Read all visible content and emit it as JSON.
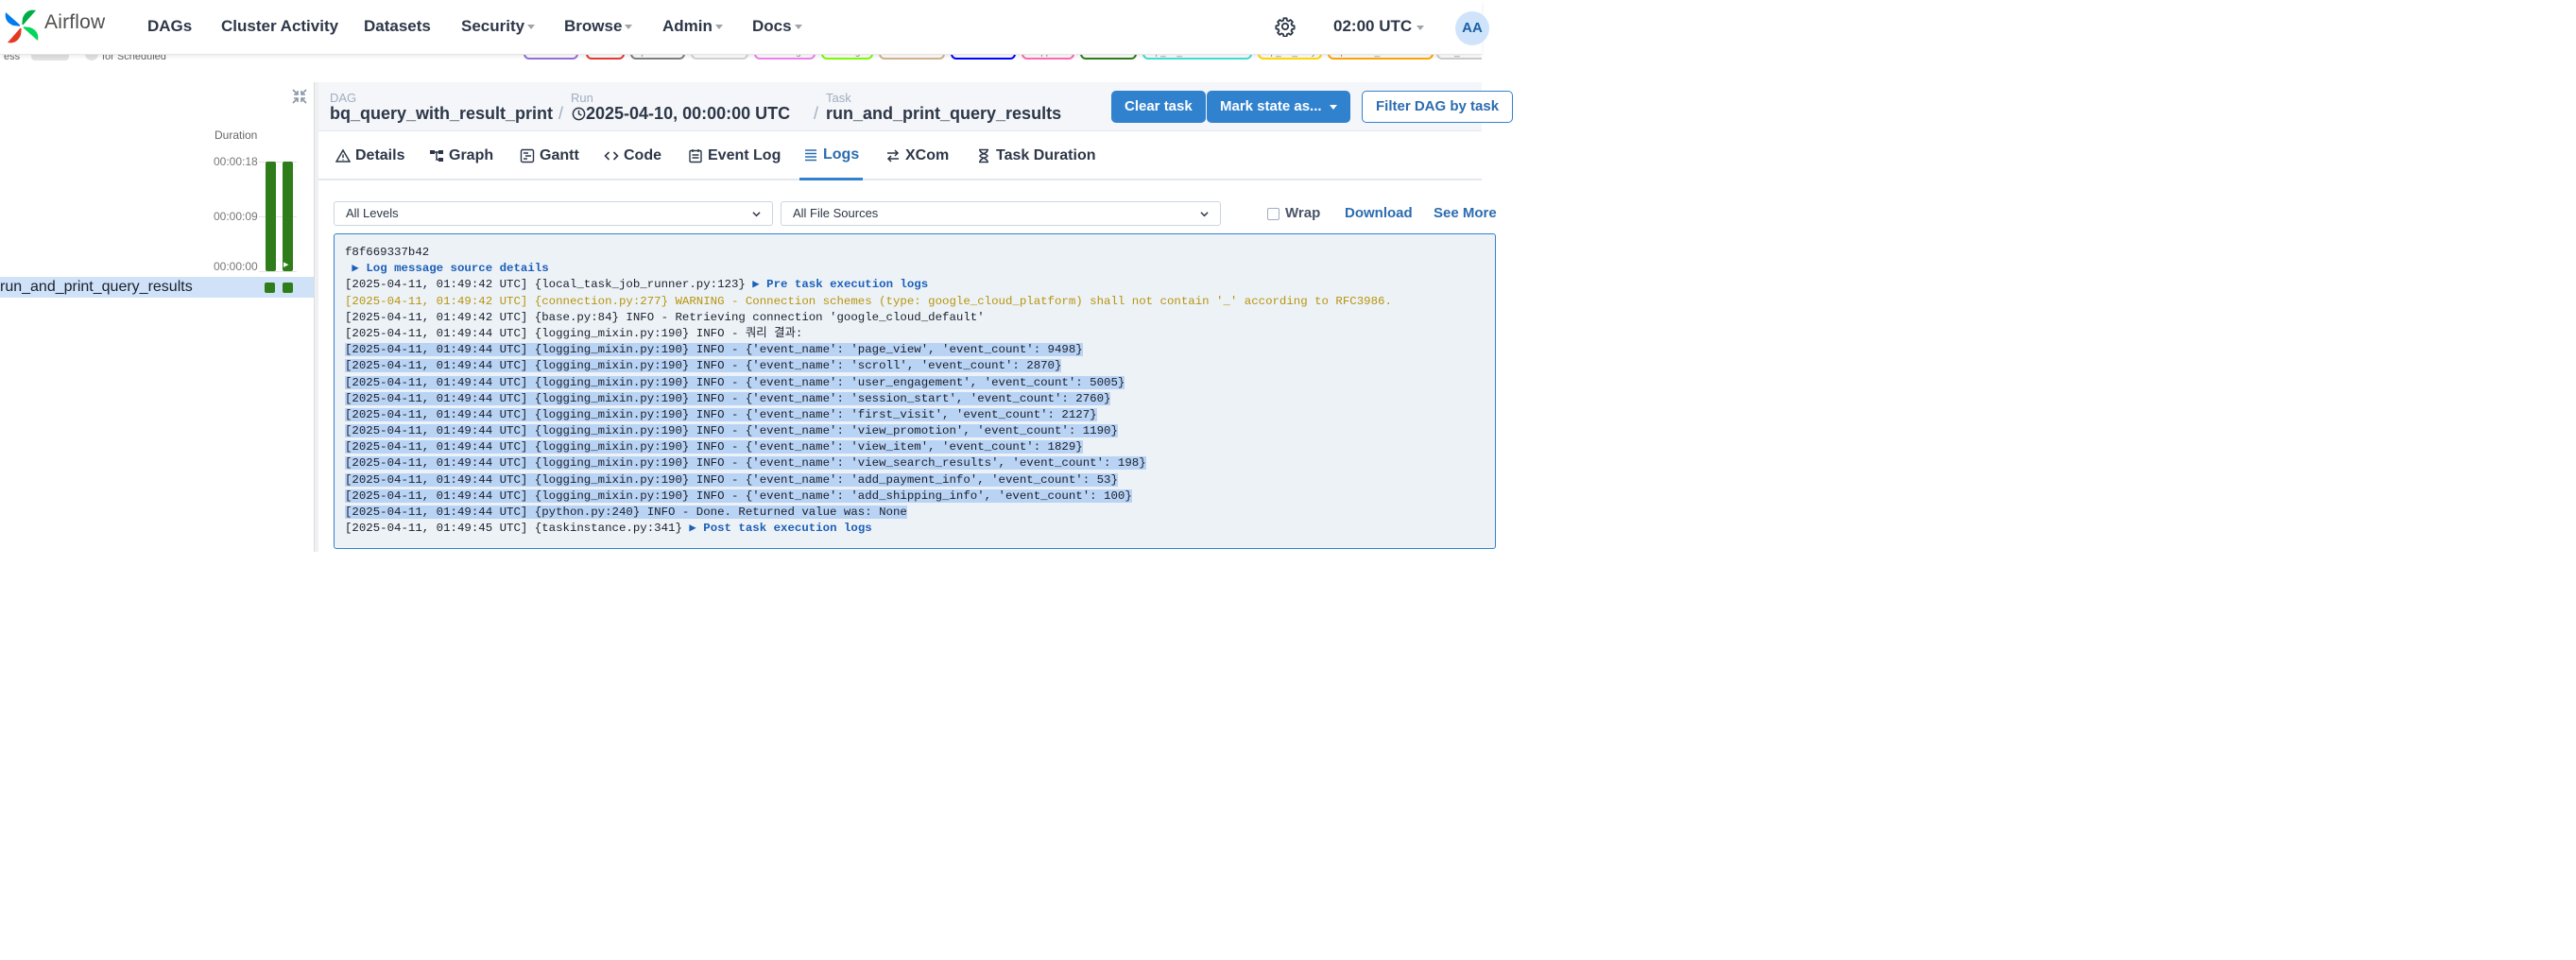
{
  "brand": {
    "name": "Airflow"
  },
  "nav": {
    "dags": "DAGs",
    "cluster_activity": "Cluster Activity",
    "datasets": "Datasets",
    "security": "Security",
    "browse": "Browse",
    "admin": "Admin",
    "docs": "Docs",
    "time": "02:00 UTC",
    "avatar": "AA"
  },
  "peek": {
    "left_text": "ess",
    "left_text2": "for Scheduled",
    "pills": [
      {
        "label": "deferred",
        "color": "#9370db"
      },
      {
        "label": "failed",
        "color": "#e53935"
      },
      {
        "label": "queued",
        "color": "#808080"
      },
      {
        "label": "removed",
        "color": "#d3d3d3"
      },
      {
        "label": "restarting",
        "color": "#ee82ee"
      },
      {
        "label": "running",
        "color": "#7cfc00"
      },
      {
        "label": "scheduled",
        "color": "#d2b48c"
      },
      {
        "label": "shutdown",
        "color": "#0000ff"
      },
      {
        "label": "skipped",
        "color": "#ff69b4"
      },
      {
        "label": "success",
        "color": "#2e7d1a"
      },
      {
        "label": "up_for_reschedule",
        "color": "#40e0d0"
      },
      {
        "label": "up_for_retry",
        "color": "#ffd700"
      },
      {
        "label": "upstream_failed",
        "color": "#ffa500"
      },
      {
        "label": "no_status",
        "color": "#ffffff"
      }
    ]
  },
  "grid": {
    "duration_label": "Duration",
    "ticks": [
      "00:00:18",
      "00:00:09",
      "00:00:00"
    ],
    "task_name": "run_and_print_query_results",
    "run_durations": [
      18,
      18
    ]
  },
  "breadcrumb": {
    "dag_label": "DAG",
    "dag_value": "bq_query_with_result_print",
    "run_label": "Run",
    "run_value": "2025-04-10, 00:00:00 UTC",
    "task_label": "Task",
    "task_value": "run_and_print_query_results"
  },
  "actions": {
    "clear_task": "Clear task",
    "mark_state": "Mark state as...",
    "filter_dag": "Filter DAG by task"
  },
  "tabs": {
    "details": "Details",
    "graph": "Graph",
    "gantt": "Gantt",
    "code": "Code",
    "event_log": "Event Log",
    "logs": "Logs",
    "xcom": "XCom",
    "task_duration": "Task Duration"
  },
  "filters": {
    "levels": "All Levels",
    "file_sources": "All File Sources",
    "wrap": "Wrap",
    "download": "Download",
    "see_more": "See More"
  },
  "logs": {
    "lines": [
      {
        "text": "f8f669337b42",
        "style": "plain"
      },
      {
        "text": " ▶ Log message source details",
        "style": "blue"
      },
      {
        "text": "[2025-04-11, 01:49:42 UTC] {local_task_job_runner.py:123} ",
        "style": "plain",
        "tail": "▶ Pre task execution logs"
      },
      {
        "text": "[2025-04-11, 01:49:42 UTC] {connection.py:277} WARNING - Connection schemes (type: google_cloud_platform) shall not contain '_' according to RFC3986.",
        "style": "warn"
      },
      {
        "text": "[2025-04-11, 01:49:42 UTC] {base.py:84} INFO - Retrieving connection 'google_cloud_default'",
        "style": "plain"
      },
      {
        "text": "[2025-04-11, 01:49:44 UTC] {logging_mixin.py:190} INFO - 쿼리 결과:",
        "style": "plain"
      },
      {
        "text": "[2025-04-11, 01:49:44 UTC] {logging_mixin.py:190} INFO - {'event_name': 'page_view', 'event_count': 9498}",
        "style": "hl"
      },
      {
        "text": "[2025-04-11, 01:49:44 UTC] {logging_mixin.py:190} INFO - {'event_name': 'scroll', 'event_count': 2870}",
        "style": "hl"
      },
      {
        "text": "[2025-04-11, 01:49:44 UTC] {logging_mixin.py:190} INFO - {'event_name': 'user_engagement', 'event_count': 5005}",
        "style": "hl"
      },
      {
        "text": "[2025-04-11, 01:49:44 UTC] {logging_mixin.py:190} INFO - {'event_name': 'session_start', 'event_count': 2760}",
        "style": "hl"
      },
      {
        "text": "[2025-04-11, 01:49:44 UTC] {logging_mixin.py:190} INFO - {'event_name': 'first_visit', 'event_count': 2127}",
        "style": "hl"
      },
      {
        "text": "[2025-04-11, 01:49:44 UTC] {logging_mixin.py:190} INFO - {'event_name': 'view_promotion', 'event_count': 1190}",
        "style": "hl"
      },
      {
        "text": "[2025-04-11, 01:49:44 UTC] {logging_mixin.py:190} INFO - {'event_name': 'view_item', 'event_count': 1829}",
        "style": "hl"
      },
      {
        "text": "[2025-04-11, 01:49:44 UTC] {logging_mixin.py:190} INFO - {'event_name': 'view_search_results', 'event_count': 198}",
        "style": "hl"
      },
      {
        "text": "[2025-04-11, 01:49:44 UTC] {logging_mixin.py:190} INFO - {'event_name': 'add_payment_info', 'event_count': 53}",
        "style": "hl"
      },
      {
        "text": "[2025-04-11, 01:49:44 UTC] {logging_mixin.py:190} INFO - {'event_name': 'add_shipping_info', 'event_count': 100}",
        "style": "hl"
      },
      {
        "text": "[2025-04-11, 01:49:44 UTC] {python.py:240} INFO - Done. Returned value was: None",
        "style": "hl"
      },
      {
        "text": "[2025-04-11, 01:49:45 UTC] {taskinstance.py:341} ",
        "style": "plain",
        "tail": "▶ Post task execution logs"
      }
    ]
  }
}
